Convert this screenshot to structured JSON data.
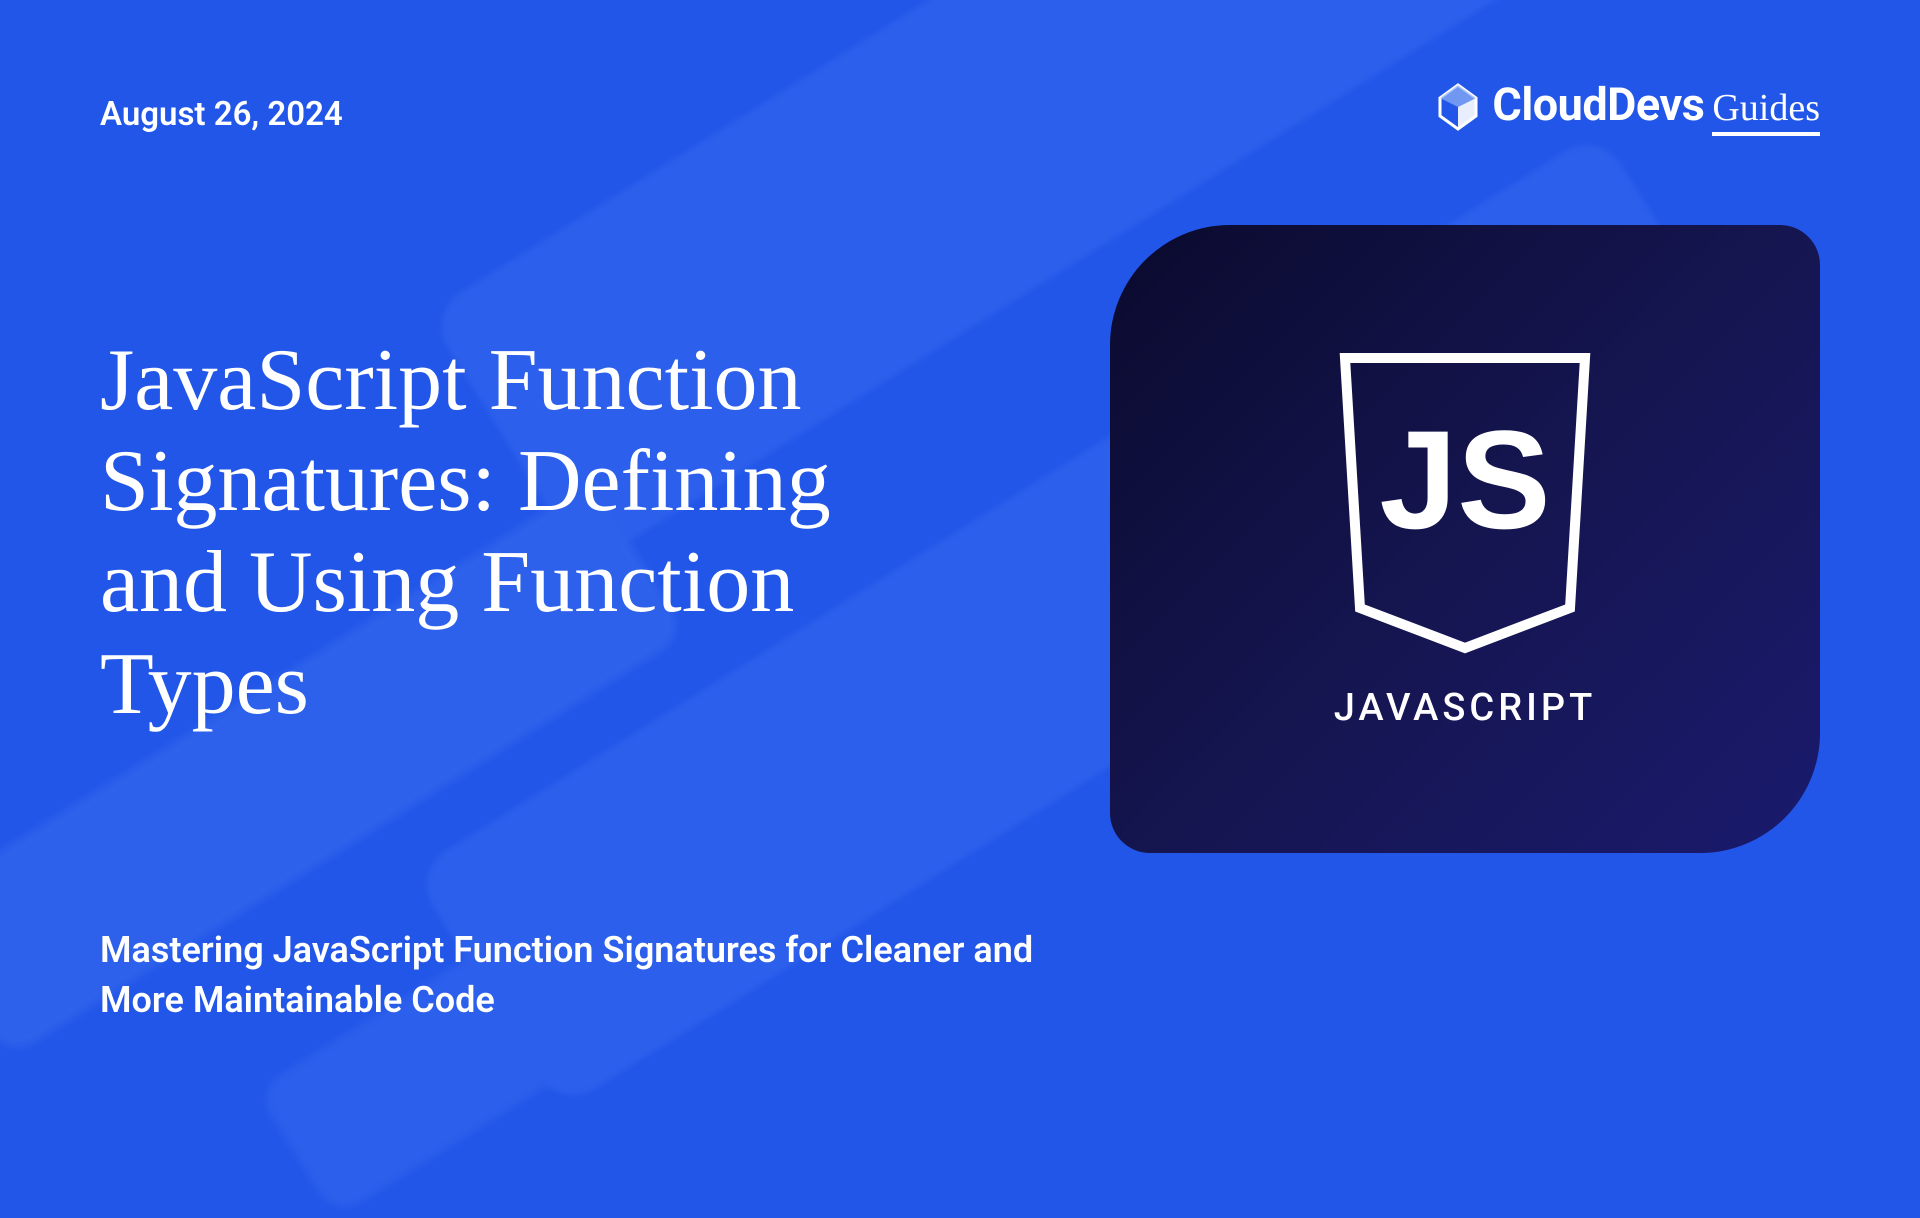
{
  "date": "August 26,  2024",
  "brand": {
    "name": "CloudDevs",
    "suffix": "Guides"
  },
  "title": "JavaScript Function Signatures: Defining and Using Function Types",
  "subtitle": "Mastering JavaScript Function Signatures for Cleaner and More Maintainable Code",
  "card": {
    "tech_label": "JAVASCRIPT",
    "shield_text": "JS"
  }
}
